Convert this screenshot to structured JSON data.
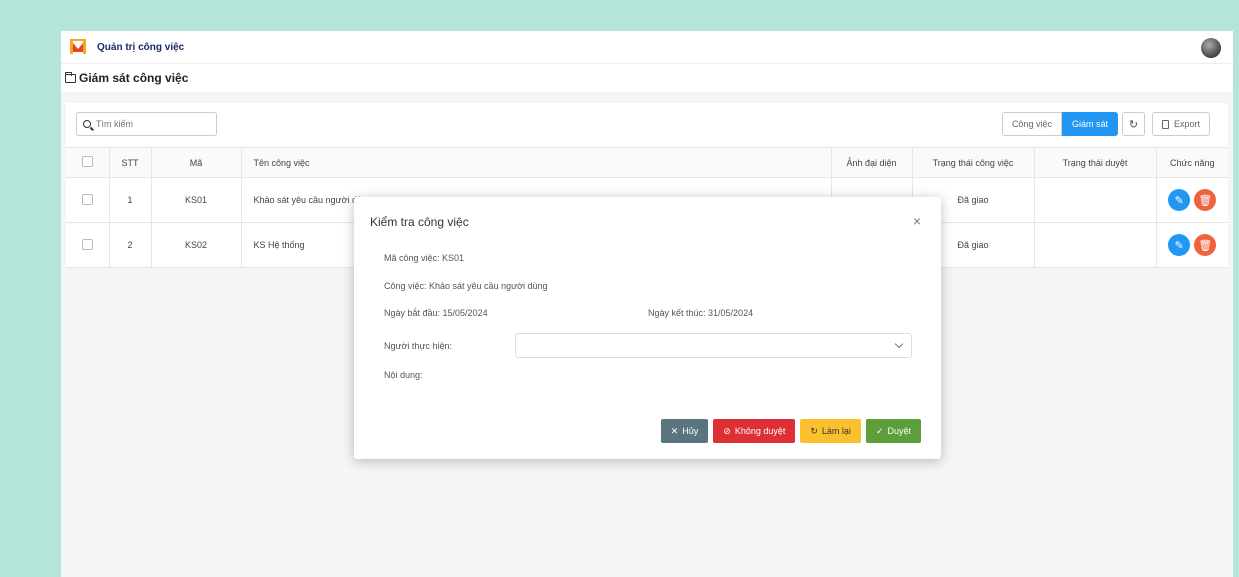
{
  "app": {
    "title": "Quản trị công việc"
  },
  "breadcrumb": {
    "title": "Giám sát công việc"
  },
  "toolbar": {
    "search_placeholder": "Tìm kiếm",
    "tab_congviec": "Công việc",
    "tab_giamsat": "Giám sát",
    "refresh_icon": "↻",
    "export_label": "Export"
  },
  "table": {
    "headers": [
      "STT",
      "Mã",
      "Tên công việc",
      "Ảnh đại diện",
      "Trạng thái công việc",
      "Trạng thái duyệt",
      "Chức năng"
    ],
    "rows": [
      {
        "stt": "1",
        "ma": "KS01",
        "ten": "Khảo sát yêu cầu người dù",
        "trangthai": "Đã giao",
        "duyet": ""
      },
      {
        "stt": "2",
        "ma": "KS02",
        "ten": "KS Hệ thống",
        "trangthai": "Đã giao",
        "duyet": ""
      }
    ]
  },
  "modal": {
    "title": "Kiểm tra công việc",
    "close": "×",
    "ma_line": "Mã công việc: KS01",
    "cv_line": "Công việc: Khảo sát yêu cầu người dùng",
    "start_line": "Ngày bắt đầu: 15/05/2024",
    "end_line": "Ngày kết thúc: 31/05/2024",
    "nguoi_label": "Người thực hiện:",
    "noidung_label": "Nội dung:",
    "btn_cancel": "Hủy",
    "btn_reject": "Không duyệt",
    "btn_reset": "Làm lại",
    "btn_approve": "Duyệt"
  },
  "colors": {
    "accent": "#2196f3",
    "danger": "#dc3034",
    "warning": "#fbc02d",
    "success": "#5c9e3a",
    "background": "#b3e5d8"
  }
}
